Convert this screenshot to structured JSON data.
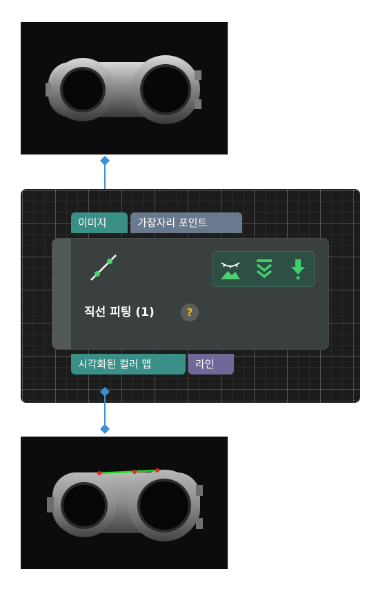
{
  "node": {
    "title": "직선 피팅 (1)",
    "help_label": "?",
    "input_ports": [
      {
        "label": "이미지",
        "color": "#3a8f87"
      },
      {
        "label": "가장자리 포인트",
        "color": "#6a7a8e"
      }
    ],
    "output_ports": [
      {
        "label": "시각화된 컬러 맵",
        "color": "#3a8f87"
      },
      {
        "label": "라인",
        "color": "#6f6898"
      }
    ],
    "icon": "line-fit-icon",
    "toolbar_icons": [
      "visualization-eye-icon",
      "collapse-chevrons-icon",
      "download-arrow-icon"
    ]
  },
  "images": {
    "input": "metal-part-input-image",
    "output": "metal-part-fitted-line-image"
  },
  "colors": {
    "connector": "#3e8fd0",
    "canvas_bg": "#1c1c1c",
    "node_bg": "#3a3f3f",
    "fit_line": "#22dd22",
    "fit_points": "#ee2222"
  }
}
